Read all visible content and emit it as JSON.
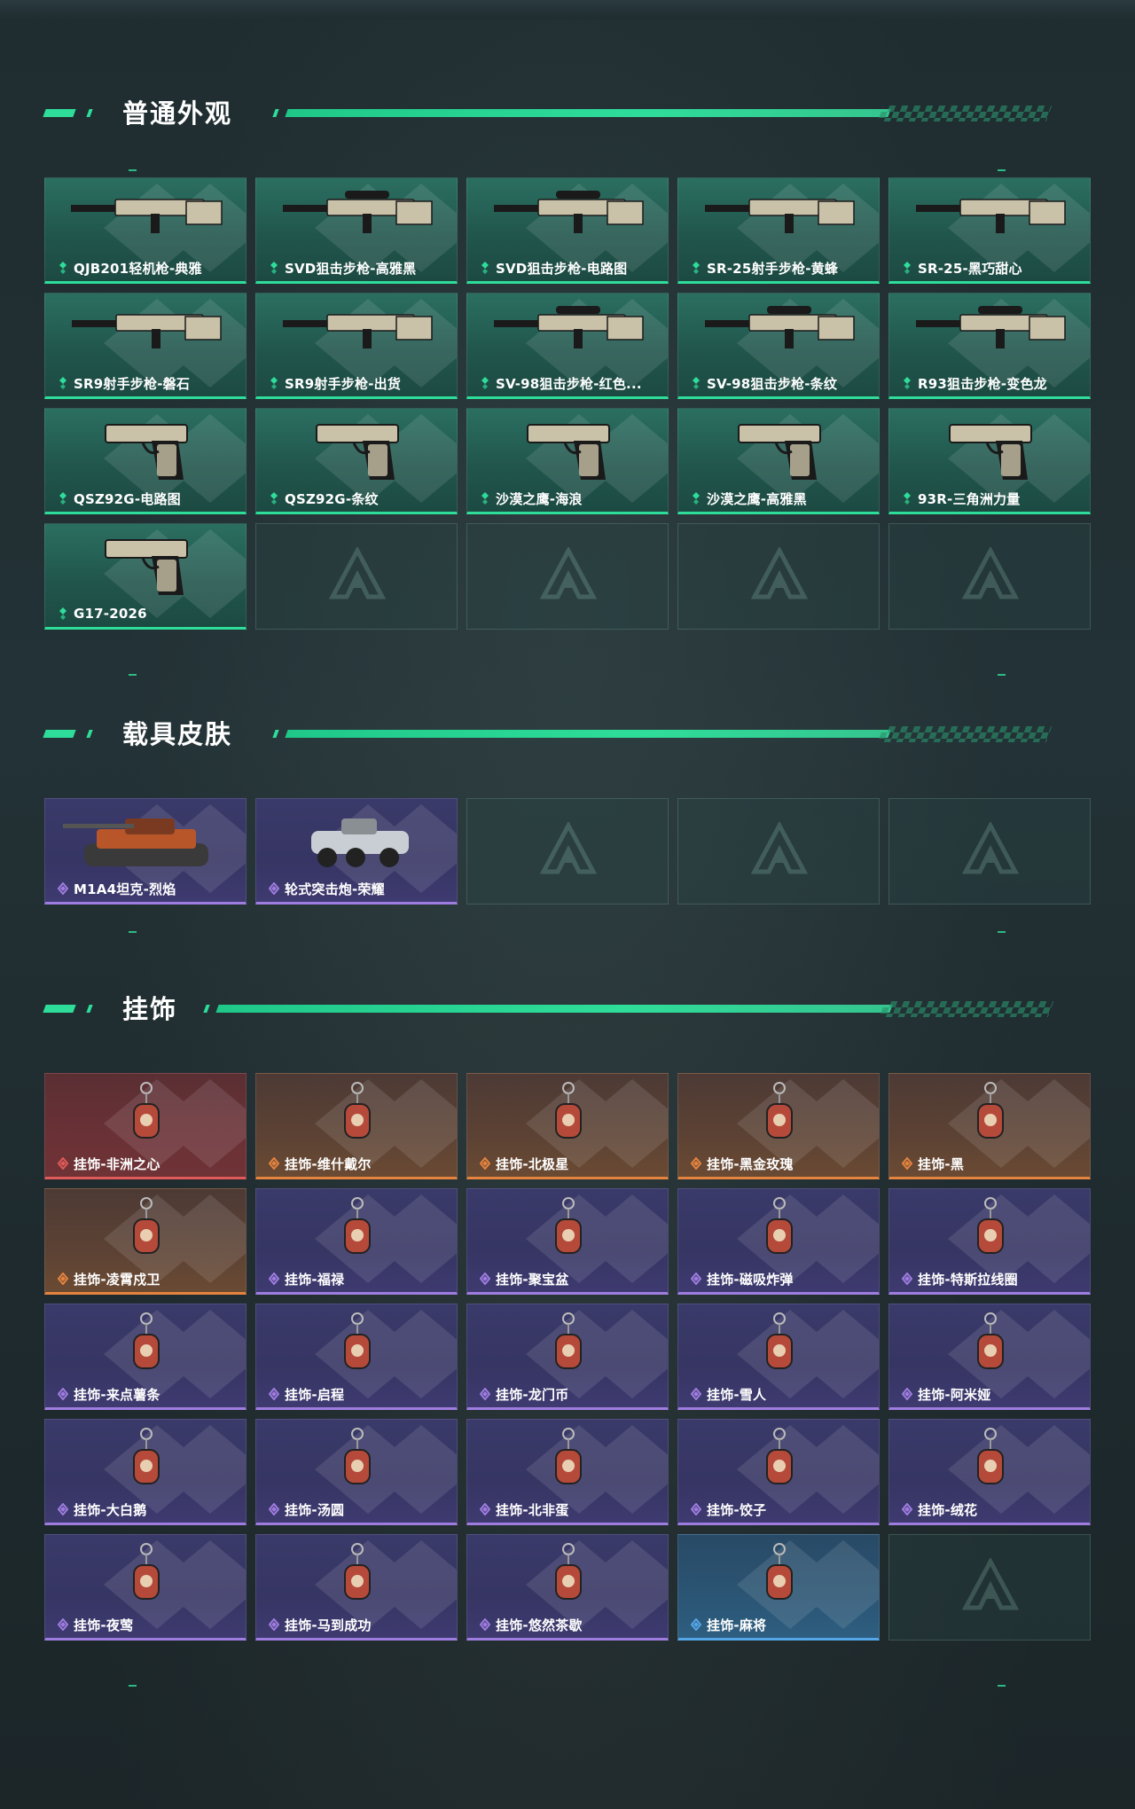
{
  "sections": {
    "skins": {
      "title": "普通外观",
      "cards": [
        {
          "label": "QJB201轻机枪-典雅",
          "rarity": "green",
          "icon": "lmg-icon"
        },
        {
          "label": "SVD狙击步枪-高雅黑",
          "rarity": "green",
          "icon": "sniper-rifle-icon"
        },
        {
          "label": "SVD狙击步枪-电路图",
          "rarity": "green",
          "icon": "sniper-rifle-icon"
        },
        {
          "label": "SR-25射手步枪-黄蜂",
          "rarity": "green",
          "icon": "rifle-icon"
        },
        {
          "label": "SR-25-黑巧甜心",
          "rarity": "green",
          "icon": "rifle-icon"
        },
        {
          "label": "SR9射手步枪-磐石",
          "rarity": "green",
          "icon": "rifle-icon"
        },
        {
          "label": "SR9射手步枪-出货",
          "rarity": "green",
          "icon": "rifle-icon"
        },
        {
          "label": "SV-98狙击步枪-红色...",
          "rarity": "green",
          "icon": "sniper-rifle-icon"
        },
        {
          "label": "SV-98狙击步枪-条纹",
          "rarity": "green",
          "icon": "sniper-rifle-icon"
        },
        {
          "label": "R93狙击步枪-变色龙",
          "rarity": "green",
          "icon": "sniper-rifle-icon"
        },
        {
          "label": "QSZ92G-电路图",
          "rarity": "green",
          "icon": "pistol-icon"
        },
        {
          "label": "QSZ92G-条纹",
          "rarity": "green",
          "icon": "pistol-icon"
        },
        {
          "label": "沙漠之鹰-海浪",
          "rarity": "green",
          "icon": "pistol-icon"
        },
        {
          "label": "沙漠之鹰-高雅黑",
          "rarity": "green",
          "icon": "pistol-icon"
        },
        {
          "label": "93R-三角洲力量",
          "rarity": "green",
          "icon": "pistol-icon"
        },
        {
          "label": "G17-2026",
          "rarity": "green",
          "icon": "pistol-icon"
        }
      ],
      "empty_count": 4
    },
    "vehicles": {
      "title": "载具皮肤",
      "cards": [
        {
          "label": "M1A4坦克-烈焰",
          "rarity": "purple",
          "icon": "tank-icon"
        },
        {
          "label": "轮式突击炮-荣耀",
          "rarity": "purple",
          "icon": "armored-car-icon"
        }
      ],
      "empty_count": 3
    },
    "charms": {
      "title": "挂饰",
      "cards": [
        {
          "label": "挂饰-非洲之心",
          "rarity": "red",
          "icon": "charm-icon"
        },
        {
          "label": "挂饰-维什戴尔",
          "rarity": "orange",
          "icon": "charm-icon"
        },
        {
          "label": "挂饰-北极星",
          "rarity": "orange",
          "icon": "charm-icon"
        },
        {
          "label": "挂饰-黑金玫瑰",
          "rarity": "orange",
          "icon": "charm-icon"
        },
        {
          "label": "挂饰-黑",
          "rarity": "orange",
          "icon": "charm-icon"
        },
        {
          "label": "挂饰-凌霄戍卫",
          "rarity": "orange",
          "icon": "charm-icon"
        },
        {
          "label": "挂饰-福禄",
          "rarity": "purple",
          "icon": "charm-icon"
        },
        {
          "label": "挂饰-聚宝盆",
          "rarity": "purple",
          "icon": "charm-icon"
        },
        {
          "label": "挂饰-磁吸炸弹",
          "rarity": "purple",
          "icon": "charm-icon"
        },
        {
          "label": "挂饰-特斯拉线圈",
          "rarity": "purple",
          "icon": "charm-icon"
        },
        {
          "label": "挂饰-来点薯条",
          "rarity": "purple",
          "icon": "charm-icon"
        },
        {
          "label": "挂饰-启程",
          "rarity": "purple",
          "icon": "charm-icon"
        },
        {
          "label": "挂饰-龙门币",
          "rarity": "purple",
          "icon": "charm-icon"
        },
        {
          "label": "挂饰-雪人",
          "rarity": "purple",
          "icon": "charm-icon"
        },
        {
          "label": "挂饰-阿米娅",
          "rarity": "purple",
          "icon": "charm-icon"
        },
        {
          "label": "挂饰-大白鹅",
          "rarity": "purple",
          "icon": "charm-icon"
        },
        {
          "label": "挂饰-汤圆",
          "rarity": "purple",
          "icon": "charm-icon"
        },
        {
          "label": "挂饰-北非蛋",
          "rarity": "purple",
          "icon": "charm-icon"
        },
        {
          "label": "挂饰-饺子",
          "rarity": "purple",
          "icon": "charm-icon"
        },
        {
          "label": "挂饰-绒花",
          "rarity": "purple",
          "icon": "charm-icon"
        },
        {
          "label": "挂饰-夜莺",
          "rarity": "purple",
          "icon": "charm-icon"
        },
        {
          "label": "挂饰-马到成功",
          "rarity": "purple",
          "icon": "charm-icon"
        },
        {
          "label": "挂饰-悠然茶歇",
          "rarity": "purple",
          "icon": "charm-icon"
        },
        {
          "label": "挂饰-麻将",
          "rarity": "blue",
          "icon": "charm-icon"
        }
      ],
      "empty_count": 1
    }
  },
  "colors": {
    "accent": "#2fdd9a",
    "rarity_green": "#2fdd9a",
    "rarity_purple": "#9f7de0",
    "rarity_red": "#e05a5a",
    "rarity_orange": "#e5843f",
    "rarity_blue": "#55a6e8"
  }
}
